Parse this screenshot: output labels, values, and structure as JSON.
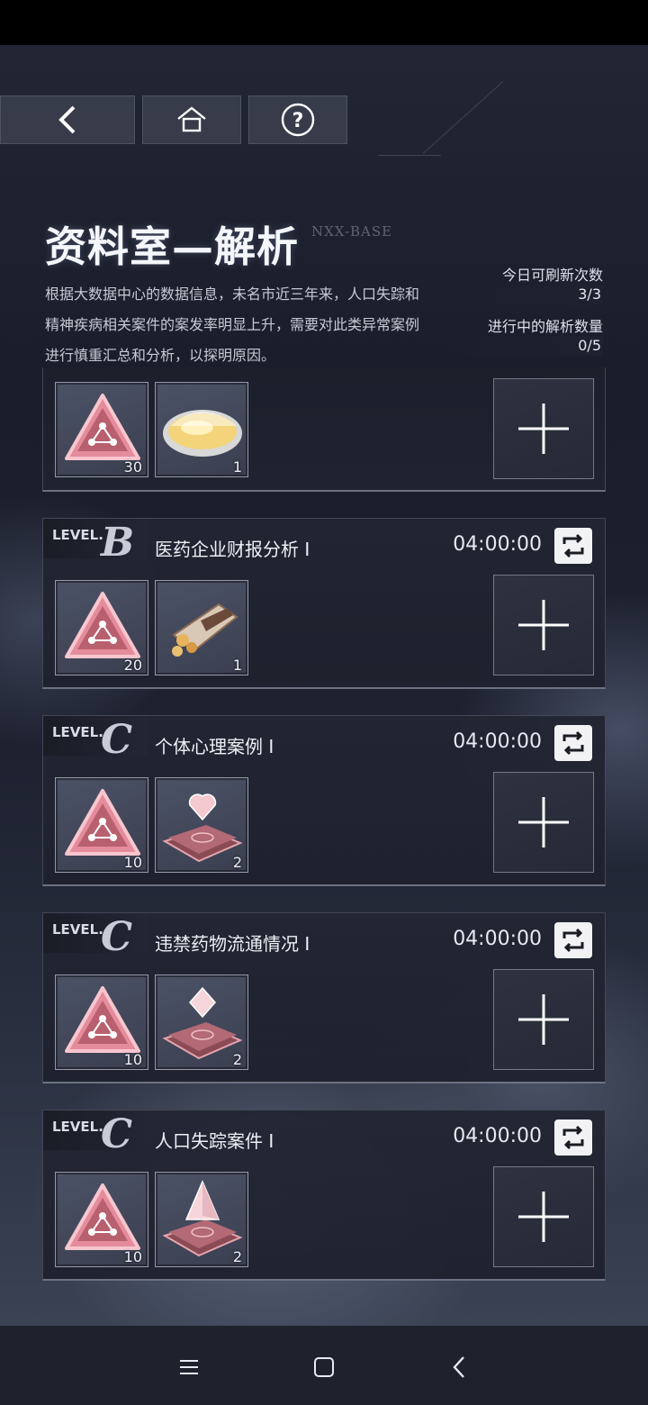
{
  "header": {
    "title": "资料室—解析",
    "tag": "NXX-BASE",
    "description": "根据大数据中心的数据信息，未名市近三年来，人口失踪和精神疾病相关案件的案发率明显上升，需要对此类异常案例进行慎重汇总和分析，以探明原因。"
  },
  "stats": {
    "refresh_label": "今日可刷新次数",
    "refresh_value": "3/3",
    "analysis_label": "进行中的解析数量",
    "analysis_value": "0/5"
  },
  "partial_card": {
    "items": [
      {
        "icon": "triangle-clue-icon",
        "count": "30"
      },
      {
        "icon": "coin-plate-icon",
        "count": "1"
      }
    ]
  },
  "cards": [
    {
      "level_text": "LEVEL.",
      "level": "B",
      "title": "医药企业财报分析 Ⅰ",
      "timer": "04:00:00",
      "items": [
        {
          "icon": "triangle-clue-icon",
          "count": "20"
        },
        {
          "icon": "snack-bag-icon",
          "count": "1"
        }
      ]
    },
    {
      "level_text": "LEVEL.",
      "level": "C",
      "title": "个体心理案例 Ⅰ",
      "timer": "04:00:00",
      "items": [
        {
          "icon": "triangle-clue-icon",
          "count": "10"
        },
        {
          "icon": "heart-crystal-icon",
          "count": "2"
        }
      ]
    },
    {
      "level_text": "LEVEL.",
      "level": "C",
      "title": "违禁药物流通情况 Ⅰ",
      "timer": "04:00:00",
      "items": [
        {
          "icon": "triangle-clue-icon",
          "count": "10"
        },
        {
          "icon": "diamond-crystal-icon",
          "count": "2"
        }
      ]
    },
    {
      "level_text": "LEVEL.",
      "level": "C",
      "title": "人口失踪案件 Ⅰ",
      "timer": "04:00:00",
      "items": [
        {
          "icon": "triangle-clue-icon",
          "count": "10"
        },
        {
          "icon": "pyramid-crystal-icon",
          "count": "2"
        }
      ]
    }
  ],
  "icons": {
    "back": "back-arrow-icon",
    "home": "home-icon",
    "help": "help-icon",
    "refresh": "refresh-icon",
    "add": "plus-icon",
    "nav_menu": "menu-icon",
    "nav_home": "square-icon",
    "nav_back": "chevron-left-icon"
  },
  "colors": {
    "accent_pink": "#e58c9c",
    "card_bg": "#22252f"
  }
}
